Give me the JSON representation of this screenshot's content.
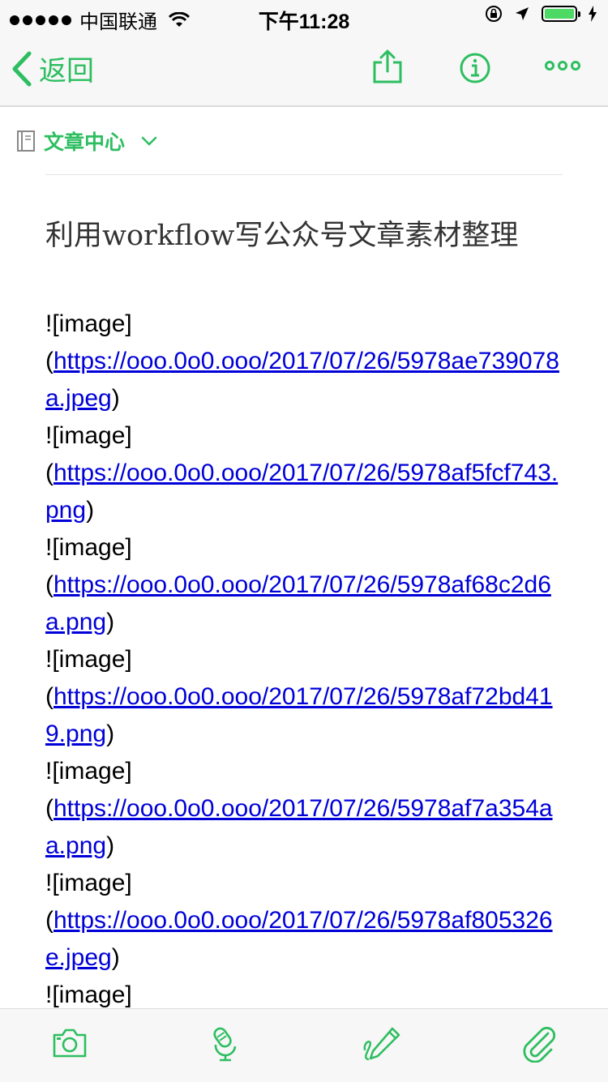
{
  "status_bar": {
    "carrier": "中国联通",
    "time": "下午11:28",
    "battery_level": 1.0
  },
  "nav": {
    "back_label": "返回"
  },
  "notebook": {
    "name": "文章中心"
  },
  "note": {
    "title": "利用workflow写公众号文章素材整理",
    "entries": [
      {
        "label": "![image]",
        "url": "https://ooo.0o0.ooo/2017/07/26/5978ae739078a.jpeg"
      },
      {
        "label": "![image]",
        "url": "https://ooo.0o0.ooo/2017/07/26/5978af5fcf743.png"
      },
      {
        "label": "![image]",
        "url": "https://ooo.0o0.ooo/2017/07/26/5978af68c2d6a.png"
      },
      {
        "label": "![image]",
        "url": "https://ooo.0o0.ooo/2017/07/26/5978af72bd419.png"
      },
      {
        "label": "![image]",
        "url": "https://ooo.0o0.ooo/2017/07/26/5978af7a354aa.png"
      },
      {
        "label": "![image]",
        "url": "https://ooo.0o0.ooo/2017/07/26/5978af805326e.jpeg"
      },
      {
        "label": "![image]",
        "url": ""
      }
    ]
  },
  "colors": {
    "accent": "#2dbe60",
    "link": "#0000d8"
  },
  "icons": {
    "share": "share-icon",
    "info": "info-icon",
    "more": "more-icon",
    "camera": "camera-icon",
    "audio": "microphone-icon",
    "sketch": "sketch-pen-icon",
    "attach": "paperclip-icon"
  }
}
